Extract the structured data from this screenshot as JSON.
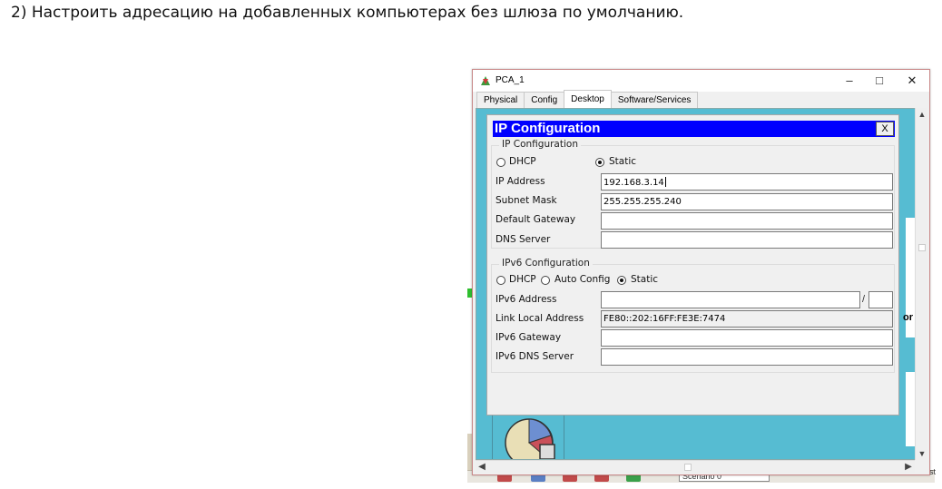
{
  "instruction": "2) Настроить адресацию на добавленных компьютерах без шлюза по умолчанию.",
  "window": {
    "title": "PCA_1",
    "minimize": "–",
    "maximize": "□",
    "close": "✕",
    "tabs": [
      "Physical",
      "Config",
      "Desktop",
      "Software/Services"
    ],
    "active_tab": "Desktop"
  },
  "ip_config": {
    "title": "IP Configuration",
    "close_label": "X",
    "ipv4": {
      "group_label": "IP Configuration",
      "dhcp_label": "DHCP",
      "static_label": "Static",
      "mode": "Static",
      "ip_address_label": "IP Address",
      "ip_address": "192.168.3.14",
      "subnet_mask_label": "Subnet Mask",
      "subnet_mask": "255.255.255.240",
      "gateway_label": "Default Gateway",
      "gateway": "",
      "dns_label": "DNS Server",
      "dns": ""
    },
    "ipv6": {
      "group_label": "IPv6 Configuration",
      "dhcp_label": "DHCP",
      "auto_label": "Auto Config",
      "static_label": "Static",
      "mode": "Static",
      "address_label": "IPv6 Address",
      "address": "",
      "prefix": "",
      "prefix_separator": "/",
      "link_local_label": "Link Local Address",
      "link_local": "FE80::202:16FF:FE3E:7474",
      "gateway_label": "IPv6 Gateway",
      "gateway": "",
      "dns_label": "IPv6 DNS Server",
      "dns": ""
    }
  },
  "background": {
    "scenario_label": "Scenario 0",
    "cut_text": "or",
    "edge_text": "st"
  },
  "colors": {
    "header_blue": "#0000ff",
    "desktop_bg": "#56bcd2",
    "window_border": "#c98a8a"
  }
}
